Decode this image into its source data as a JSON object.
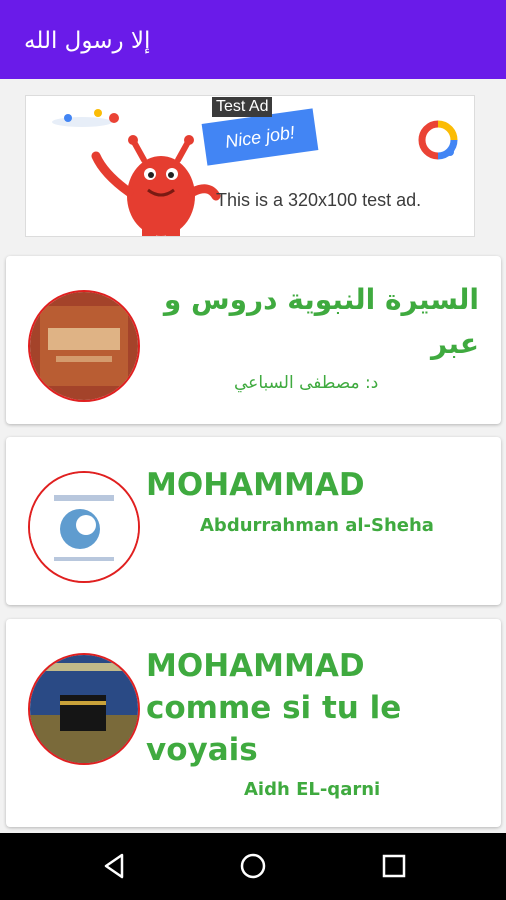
{
  "appbar": {
    "title": "إلا رسول الله",
    "color": "#6a1be9"
  },
  "ad": {
    "badge": "Test Ad",
    "headline": "Nice job!",
    "text": "This is a 320x100 test ad."
  },
  "items": [
    {
      "title": "السيرة النبوية دروس و عبر",
      "subtitle": "د: مصطفى السباعي"
    },
    {
      "title": "MOHAMMAD",
      "subtitle": "Abdurrahman al-Sheha"
    },
    {
      "title": "MOHAMMAD comme si tu le voyais",
      "subtitle": "Aidh EL-qarni"
    }
  ],
  "colors": {
    "accent_green": "#3faa3f",
    "thumb_border": "#e02020"
  },
  "navbar": {
    "icons": [
      "back-icon",
      "home-icon",
      "recents-icon"
    ]
  }
}
